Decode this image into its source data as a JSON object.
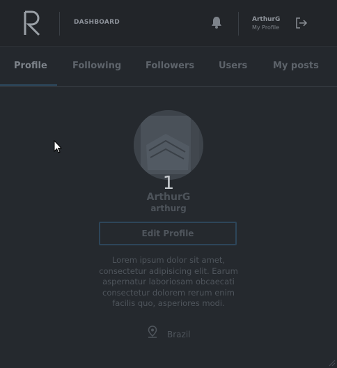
{
  "header": {
    "dashboard_label": "DASHBOARD",
    "user_name": "ArthurG",
    "user_subtitle": "My Profile",
    "icons": {
      "logo": "r-logo-icon",
      "notifications": "bell-icon",
      "logout": "logout-icon"
    }
  },
  "tabs": [
    {
      "label": "Profile",
      "active": true
    },
    {
      "label": "Following",
      "active": false
    },
    {
      "label": "Followers",
      "active": false
    },
    {
      "label": "Users",
      "active": false
    },
    {
      "label": "My posts",
      "active": false
    }
  ],
  "profile": {
    "avatar_badge": "1",
    "name": "ArthurG",
    "handle": "arthurg",
    "edit_label": "Edit Profile",
    "bio": "Lorem ipsum dolor sit amet, consectetur adipisicing elit. Earum aspernatur laboriosam obcaecati consectetur dolorem rerum enim facilis quo, asperiores modi.",
    "location": "Brazil"
  },
  "colors": {
    "background": "#25292e",
    "topbar": "#222529",
    "accent_border": "#2d4559"
  }
}
